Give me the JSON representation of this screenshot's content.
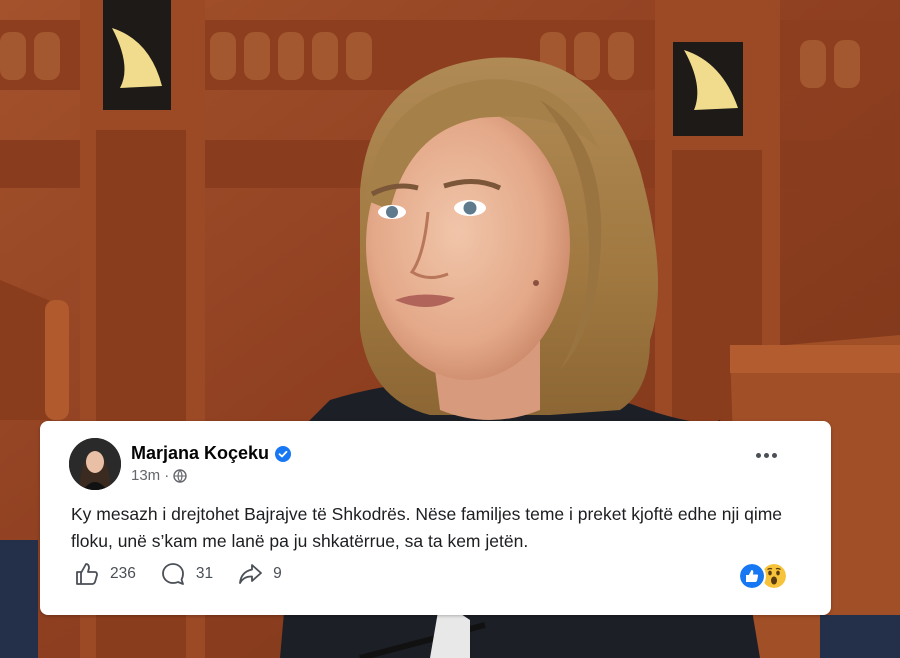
{
  "post": {
    "author": "Marjana Koçeku",
    "time": "13m",
    "separator": "·",
    "text": "Ky mesazh i drejtohet Bajrajve të Shkodrës. Nëse familjes teme i preket kjoftë edhe nji qime floku, unë s’kam me lanë pa ju shkatërrue, sa ta kem jetën."
  },
  "actions": {
    "likes": "236",
    "comments": "31",
    "shares": "9"
  },
  "icons": {
    "verified": "verified-badge-icon",
    "audience": "globe-icon",
    "more": "more-options-icon",
    "like": "thumbs-up-icon",
    "comment": "comment-icon",
    "share": "share-icon",
    "reaction_like": "like-reaction-icon",
    "reaction_wow": "wow-reaction-icon"
  },
  "colors": {
    "facebook_blue": "#1877f2",
    "wood": "#9a4a28",
    "text": "#1c1e21",
    "meta": "#65676b"
  }
}
